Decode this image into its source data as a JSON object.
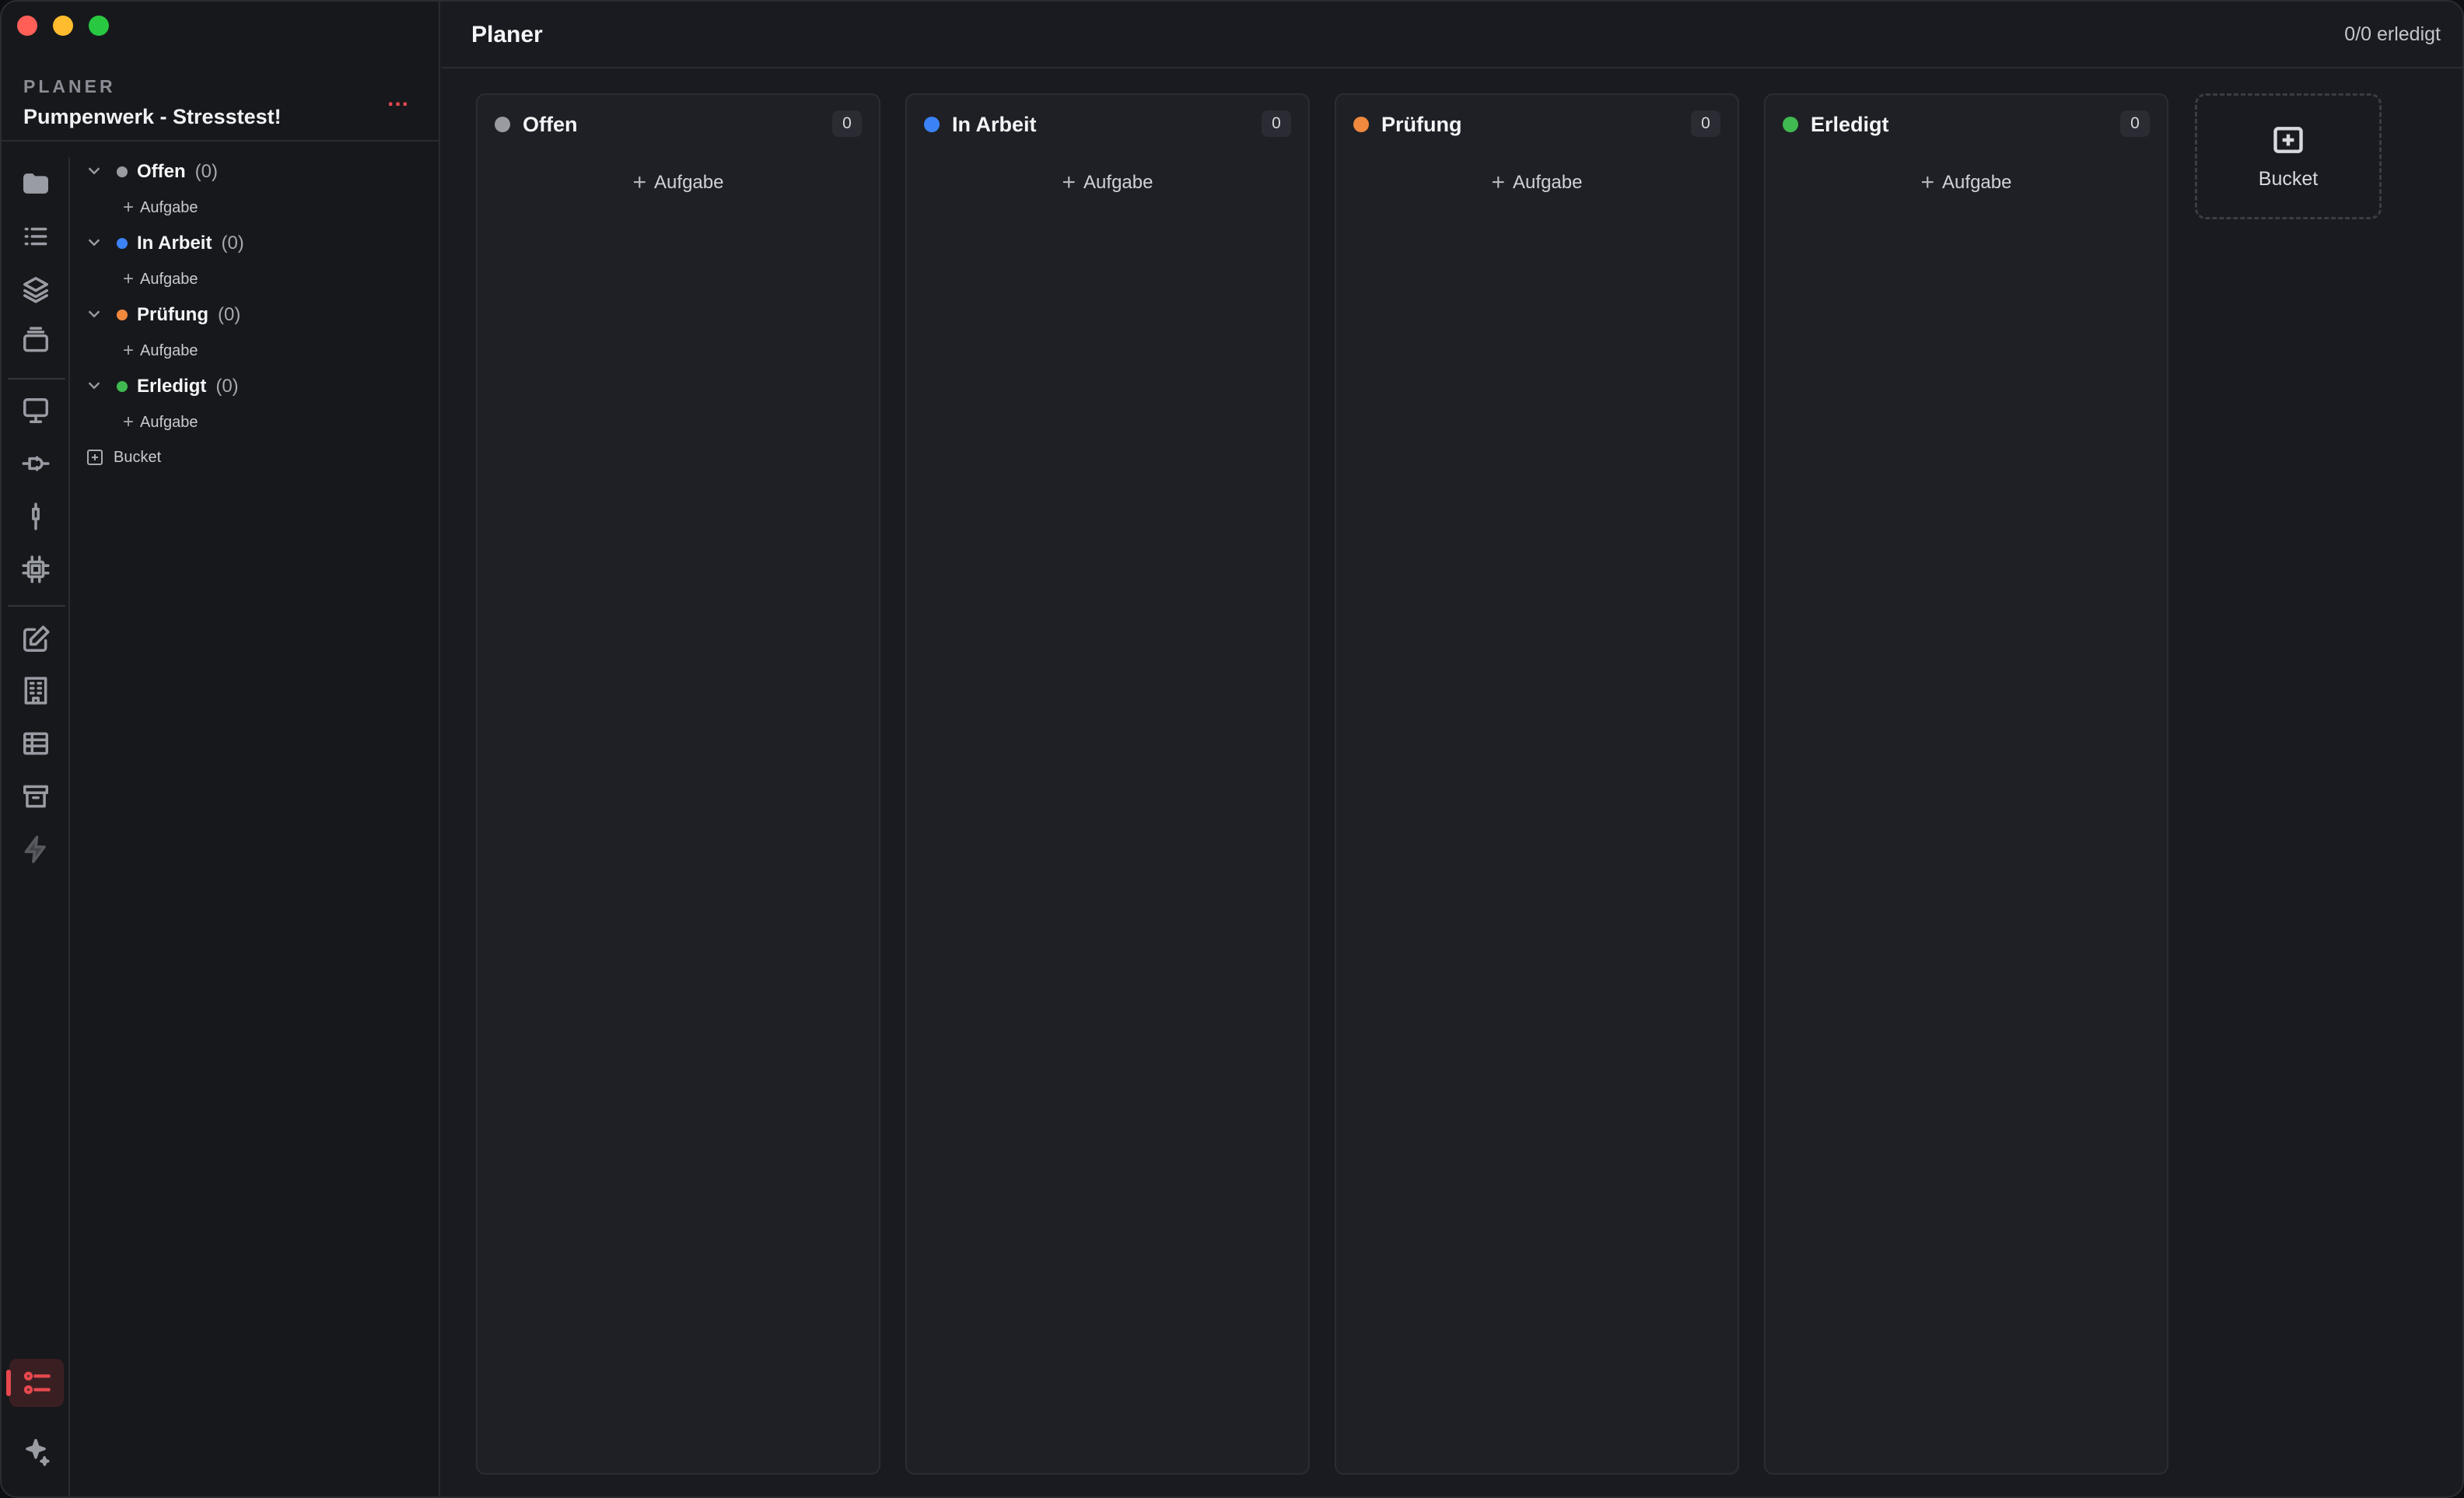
{
  "window": {
    "app": "Planer"
  },
  "sidebar": {
    "kicker": "PLANER",
    "project": "Pumpenwerk - Stresstest!",
    "more_label": "...",
    "groups": [
      {
        "name": "Offen",
        "count": "(0)",
        "color": "#9a9ba1",
        "add_label": "Aufgabe"
      },
      {
        "name": "In Arbeit",
        "count": "(0)",
        "color": "#3b82f6",
        "add_label": "Aufgabe"
      },
      {
        "name": "Prüfung",
        "count": "(0)",
        "color": "#f0883e",
        "add_label": "Aufgabe"
      },
      {
        "name": "Erledigt",
        "count": "(0)",
        "color": "#3fb950",
        "add_label": "Aufgabe"
      }
    ],
    "bucket_label": "Bucket"
  },
  "rail": {
    "icons": [
      "folder-icon",
      "list-icon",
      "layers-icon",
      "stack-icon",
      "monitor-icon",
      "plug-icon",
      "pin-icon",
      "chip-icon",
      "edit-icon",
      "building-icon",
      "table-icon",
      "archive-icon",
      "bolt-icon",
      "planner-icon",
      "sparkle-icon"
    ]
  },
  "header": {
    "title": "Planer",
    "status": "0/0 erledigt"
  },
  "board": {
    "columns": [
      {
        "name": "Offen",
        "count": "0",
        "color": "#9a9ba1",
        "add_label": "Aufgabe"
      },
      {
        "name": "In Arbeit",
        "count": "0",
        "color": "#3b82f6",
        "add_label": "Aufgabe"
      },
      {
        "name": "Prüfung",
        "count": "0",
        "color": "#f0883e",
        "add_label": "Aufgabe"
      },
      {
        "name": "Erledigt",
        "count": "0",
        "color": "#3fb950",
        "add_label": "Aufgabe"
      }
    ],
    "add_bucket_label": "Bucket"
  }
}
